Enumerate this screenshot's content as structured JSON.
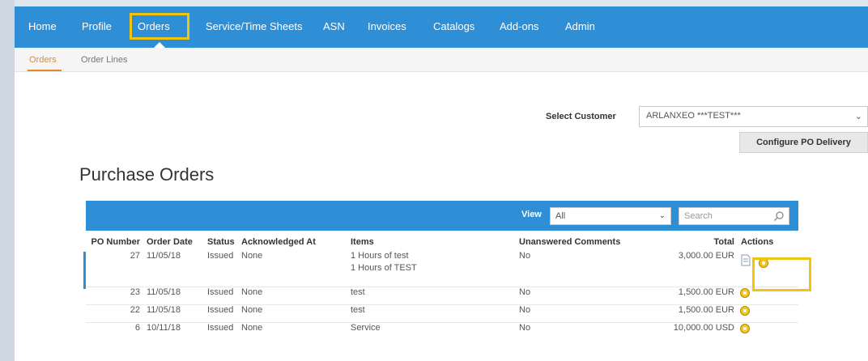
{
  "nav": {
    "items": [
      "Home",
      "Profile",
      "Orders",
      "Service/Time Sheets",
      "ASN",
      "Invoices",
      "Catalogs",
      "Add-ons",
      "Admin"
    ],
    "active": "Orders"
  },
  "subnav": {
    "items": [
      "Orders",
      "Order Lines"
    ],
    "active": "Orders"
  },
  "customer": {
    "label": "Select Customer",
    "value": "ARLANXEO ***TEST***"
  },
  "configure_button": "Configure PO Delivery",
  "page_title": "Purchase Orders",
  "toolbar": {
    "view_label": "View",
    "view_value": "All",
    "search_placeholder": "Search"
  },
  "table": {
    "headers": [
      "PO Number",
      "Order Date",
      "Status",
      "Acknowledged At",
      "Items",
      "Unanswered Comments",
      "Total",
      "Actions"
    ],
    "rows": [
      {
        "po": "27",
        "date": "11/05/18",
        "status": "Issued",
        "ack": "None",
        "items": [
          "1 Hours of test",
          "1 Hours of TEST"
        ],
        "comments": "No",
        "total": "3,000.00 EUR"
      },
      {
        "po": "23",
        "date": "11/05/18",
        "status": "Issued",
        "ack": "None",
        "items": [
          "test"
        ],
        "comments": "No",
        "total": "1,500.00 EUR"
      },
      {
        "po": "22",
        "date": "11/05/18",
        "status": "Issued",
        "ack": "None",
        "items": [
          "test"
        ],
        "comments": "No",
        "total": "1,500.00 EUR"
      },
      {
        "po": "6",
        "date": "10/11/18",
        "status": "Issued",
        "ack": "None",
        "items": [
          "Service"
        ],
        "comments": "No",
        "total": "10,000.00 USD"
      }
    ]
  },
  "icons": {
    "document": "document-icon",
    "gear": "gear-icon",
    "search": "search-icon",
    "chevron": "chevron-down-icon"
  },
  "colors": {
    "nav_bg": "#2f8fd6",
    "highlight": "#f1c40f",
    "subnav_active": "#e58a2b"
  }
}
